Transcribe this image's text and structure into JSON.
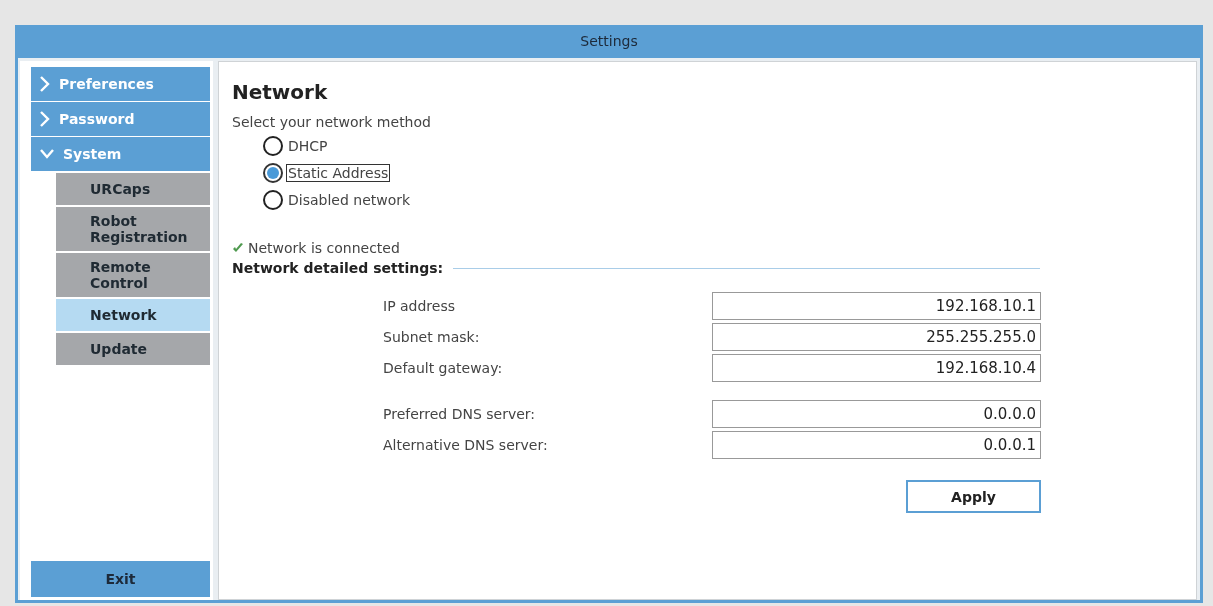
{
  "window": {
    "title": "Settings"
  },
  "sidebar": {
    "items": [
      {
        "label": "Preferences",
        "expanded": false,
        "selected": false
      },
      {
        "label": "Password",
        "expanded": false,
        "selected": false
      },
      {
        "label": "System",
        "expanded": true,
        "selected": false,
        "children": [
          {
            "label": "URCaps",
            "selected": false
          },
          {
            "label": "Robot Registration",
            "selected": false
          },
          {
            "label": "Remote Control",
            "selected": false
          },
          {
            "label": "Network",
            "selected": true
          },
          {
            "label": "Update",
            "selected": false
          }
        ]
      }
    ],
    "exit_button": "Exit"
  },
  "content": {
    "title": "Network",
    "prompt": "Select your network method",
    "methods": [
      {
        "label": "DHCP",
        "selected": false,
        "focused": false
      },
      {
        "label": "Static Address",
        "selected": true,
        "focused": true
      },
      {
        "label": "Disabled network",
        "selected": false,
        "focused": false
      }
    ],
    "status": {
      "text": "Network is connected",
      "connected": true
    },
    "section_title": "Network detailed settings:",
    "field_groups": [
      [
        {
          "label": "IP address",
          "value": "192.168.10.1"
        },
        {
          "label": "Subnet mask:",
          "value": "255.255.255.0"
        },
        {
          "label": "Default gateway:",
          "value": "192.168.10.4"
        }
      ],
      [
        {
          "label": "Preferred DNS server:",
          "value": "0.0.0.0"
        },
        {
          "label": "Alternative DNS server:",
          "value": "0.0.0.1"
        }
      ]
    ],
    "apply_button": "Apply"
  }
}
